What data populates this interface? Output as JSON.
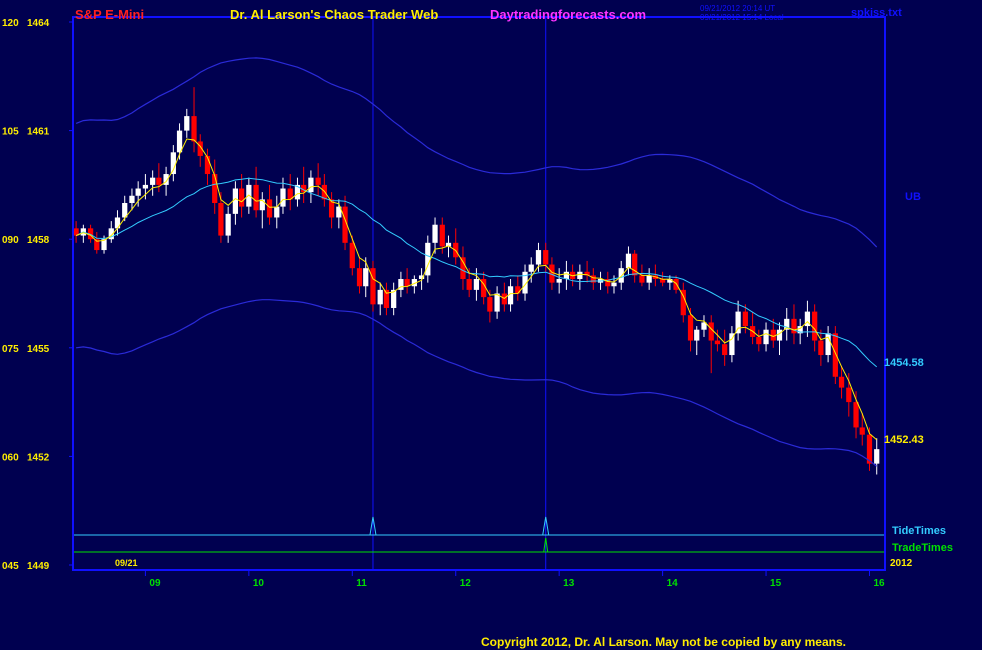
{
  "header": {
    "instrument": "S&P E-Mini",
    "title": "Dr. Al Larson's Chaos Trader Web",
    "site": "Daytradingforecasts.com",
    "time_utc": "09/21/2012 20:14 UT",
    "time_local": "09/21/2012 15:14 Local",
    "file": "spkiss.txt"
  },
  "footer": {
    "copyright": "Copyright 2012, Dr. Al Larson. May not be copied by any means."
  },
  "chart_data": {
    "type": "candlestick",
    "y_axis": {
      "ylim": [
        1449,
        1464
      ],
      "ticks": [
        {
          "code": "120",
          "price": "1464",
          "value": 1464
        },
        {
          "code": "105",
          "price": "1461",
          "value": 1461
        },
        {
          "code": "090",
          "price": "1458",
          "value": 1458
        },
        {
          "code": "075",
          "price": "1455",
          "value": 1455
        },
        {
          "code": "060",
          "price": "1452",
          "value": 1452
        },
        {
          "code": "045",
          "price": "1449",
          "value": 1449
        }
      ]
    },
    "x_axis": {
      "xlim": [
        8.3,
        16.15
      ],
      "ticks": [
        {
          "label": "09",
          "value": 9
        },
        {
          "label": "10",
          "value": 10
        },
        {
          "label": "11",
          "value": 11
        },
        {
          "label": "12",
          "value": 12
        },
        {
          "label": "13",
          "value": 13
        },
        {
          "label": "14",
          "value": 14
        },
        {
          "label": "15",
          "value": 15
        },
        {
          "label": "16",
          "value": 16
        }
      ],
      "date_label": "09/21",
      "year_label": "2012"
    },
    "colors": {
      "up": "#ffffff",
      "down": "#ff0000",
      "frame": "#1010ff",
      "bands": "#2a2ad8",
      "mid": "#33ccff",
      "fast": "#ffee00",
      "tide": "#33ccff",
      "trade": "#00e000"
    },
    "labels": {
      "upper_band": "UB",
      "mid_value": "1454.58",
      "fast_value": "1452.43",
      "tide": "TideTimes",
      "trade": "TradeTimes"
    },
    "markers": [
      11.2,
      12.87
    ],
    "candles": [
      [
        8.33,
        1458.3,
        1458.5,
        1457.9,
        1458.1
      ],
      [
        8.4,
        1458.1,
        1458.4,
        1457.9,
        1458.3
      ],
      [
        8.47,
        1458.3,
        1458.4,
        1457.9,
        1458.0
      ],
      [
        8.53,
        1458.0,
        1458.2,
        1457.6,
        1457.7
      ],
      [
        8.6,
        1457.7,
        1458.1,
        1457.6,
        1458.0
      ],
      [
        8.67,
        1458.0,
        1458.5,
        1457.9,
        1458.3
      ],
      [
        8.73,
        1458.3,
        1458.8,
        1458.1,
        1458.6
      ],
      [
        8.8,
        1458.6,
        1459.2,
        1458.5,
        1459.0
      ],
      [
        8.87,
        1459.0,
        1459.4,
        1458.8,
        1459.2
      ],
      [
        8.93,
        1459.2,
        1459.6,
        1458.9,
        1459.4
      ],
      [
        9.0,
        1459.4,
        1459.8,
        1459.1,
        1459.5
      ],
      [
        9.07,
        1459.5,
        1459.9,
        1459.2,
        1459.7
      ],
      [
        9.13,
        1459.7,
        1460.1,
        1459.3,
        1459.5
      ],
      [
        9.2,
        1459.5,
        1460.0,
        1459.2,
        1459.8
      ],
      [
        9.27,
        1459.8,
        1460.6,
        1459.6,
        1460.4
      ],
      [
        9.33,
        1460.4,
        1461.2,
        1460.2,
        1461.0
      ],
      [
        9.4,
        1461.0,
        1461.6,
        1460.8,
        1461.4
      ],
      [
        9.47,
        1461.4,
        1462.2,
        1460.4,
        1460.7
      ],
      [
        9.53,
        1460.7,
        1460.9,
        1460.0,
        1460.3
      ],
      [
        9.6,
        1460.3,
        1460.5,
        1459.5,
        1459.8
      ],
      [
        9.67,
        1459.8,
        1460.2,
        1458.7,
        1459.0
      ],
      [
        9.73,
        1459.0,
        1459.3,
        1457.9,
        1458.1
      ],
      [
        9.8,
        1458.1,
        1458.9,
        1457.9,
        1458.7
      ],
      [
        9.87,
        1458.7,
        1459.6,
        1458.4,
        1459.4
      ],
      [
        9.93,
        1459.4,
        1459.8,
        1458.6,
        1458.9
      ],
      [
        10.0,
        1458.9,
        1459.7,
        1458.7,
        1459.5
      ],
      [
        10.07,
        1459.5,
        1460.0,
        1458.6,
        1458.8
      ],
      [
        10.13,
        1458.8,
        1459.3,
        1458.3,
        1459.1
      ],
      [
        10.2,
        1459.1,
        1459.5,
        1458.4,
        1458.6
      ],
      [
        10.27,
        1458.6,
        1459.2,
        1458.3,
        1458.9
      ],
      [
        10.33,
        1458.9,
        1459.7,
        1458.7,
        1459.4
      ],
      [
        10.4,
        1459.4,
        1459.8,
        1458.8,
        1459.1
      ],
      [
        10.47,
        1459.1,
        1459.7,
        1458.9,
        1459.5
      ],
      [
        10.53,
        1459.5,
        1460.0,
        1459.0,
        1459.3
      ],
      [
        10.6,
        1459.3,
        1459.9,
        1459.0,
        1459.7
      ],
      [
        10.67,
        1459.7,
        1460.1,
        1459.2,
        1459.5
      ],
      [
        10.73,
        1459.5,
        1459.8,
        1458.9,
        1459.1
      ],
      [
        10.8,
        1459.1,
        1459.3,
        1458.3,
        1458.6
      ],
      [
        10.87,
        1458.6,
        1459.1,
        1458.3,
        1458.9
      ],
      [
        10.93,
        1458.9,
        1459.2,
        1457.7,
        1457.9
      ],
      [
        11.0,
        1457.9,
        1458.1,
        1457.0,
        1457.2
      ],
      [
        11.07,
        1457.2,
        1457.5,
        1456.5,
        1456.7
      ],
      [
        11.13,
        1456.7,
        1457.5,
        1456.4,
        1457.2
      ],
      [
        11.2,
        1457.2,
        1457.4,
        1456.0,
        1456.2
      ],
      [
        11.27,
        1456.2,
        1456.8,
        1455.9,
        1456.6
      ],
      [
        11.33,
        1456.6,
        1456.8,
        1455.9,
        1456.1
      ],
      [
        11.4,
        1456.1,
        1456.8,
        1455.9,
        1456.6
      ],
      [
        11.47,
        1456.6,
        1457.1,
        1456.4,
        1456.9
      ],
      [
        11.53,
        1456.9,
        1457.2,
        1456.5,
        1456.7
      ],
      [
        11.6,
        1456.7,
        1457.0,
        1456.5,
        1456.9
      ],
      [
        11.67,
        1456.9,
        1457.2,
        1456.6,
        1457.0
      ],
      [
        11.73,
        1457.0,
        1458.1,
        1456.8,
        1457.9
      ],
      [
        11.8,
        1457.9,
        1458.6,
        1457.6,
        1458.4
      ],
      [
        11.87,
        1458.4,
        1458.6,
        1457.6,
        1457.8
      ],
      [
        11.93,
        1457.8,
        1458.1,
        1457.5,
        1457.9
      ],
      [
        12.0,
        1457.9,
        1458.3,
        1457.3,
        1457.5
      ],
      [
        12.07,
        1457.5,
        1457.8,
        1456.6,
        1456.9
      ],
      [
        12.13,
        1456.9,
        1457.2,
        1456.4,
        1456.6
      ],
      [
        12.2,
        1456.6,
        1457.2,
        1456.3,
        1456.9
      ],
      [
        12.27,
        1456.9,
        1457.1,
        1456.2,
        1456.4
      ],
      [
        12.33,
        1456.4,
        1456.6,
        1455.7,
        1456.0
      ],
      [
        12.4,
        1456.0,
        1456.7,
        1455.8,
        1456.5
      ],
      [
        12.47,
        1456.5,
        1456.8,
        1456.0,
        1456.2
      ],
      [
        12.53,
        1456.2,
        1456.9,
        1456.0,
        1456.7
      ],
      [
        12.6,
        1456.7,
        1457.0,
        1456.3,
        1456.5
      ],
      [
        12.67,
        1456.5,
        1457.3,
        1456.3,
        1457.1
      ],
      [
        12.73,
        1457.1,
        1457.5,
        1456.8,
        1457.3
      ],
      [
        12.8,
        1457.3,
        1457.9,
        1457.1,
        1457.7
      ],
      [
        12.87,
        1457.7,
        1457.9,
        1457.1,
        1457.3
      ],
      [
        12.93,
        1457.3,
        1457.5,
        1456.6,
        1456.8
      ],
      [
        13.0,
        1456.8,
        1457.2,
        1456.5,
        1456.9
      ],
      [
        13.07,
        1456.9,
        1457.4,
        1456.6,
        1457.1
      ],
      [
        13.13,
        1457.1,
        1457.3,
        1456.7,
        1456.9
      ],
      [
        13.2,
        1456.9,
        1457.3,
        1456.6,
        1457.1
      ],
      [
        13.27,
        1457.1,
        1457.4,
        1456.8,
        1457.0
      ],
      [
        13.33,
        1457.0,
        1457.2,
        1456.6,
        1456.8
      ],
      [
        13.4,
        1456.8,
        1457.1,
        1456.6,
        1456.9
      ],
      [
        13.47,
        1456.9,
        1457.1,
        1456.5,
        1456.7
      ],
      [
        13.53,
        1456.7,
        1457.0,
        1456.5,
        1456.8
      ],
      [
        13.6,
        1456.8,
        1457.4,
        1456.6,
        1457.2
      ],
      [
        13.67,
        1457.2,
        1457.8,
        1457.0,
        1457.6
      ],
      [
        13.73,
        1457.6,
        1457.7,
        1456.8,
        1457.0
      ],
      [
        13.8,
        1457.0,
        1457.3,
        1456.7,
        1456.8
      ],
      [
        13.87,
        1456.8,
        1457.2,
        1456.6,
        1457.0
      ],
      [
        13.93,
        1457.0,
        1457.3,
        1456.7,
        1456.9
      ],
      [
        14.0,
        1456.9,
        1457.1,
        1456.7,
        1456.8
      ],
      [
        14.07,
        1456.8,
        1457.0,
        1456.6,
        1456.9
      ],
      [
        14.13,
        1456.9,
        1457.0,
        1456.5,
        1456.6
      ],
      [
        14.2,
        1456.6,
        1456.8,
        1455.7,
        1455.9
      ],
      [
        14.27,
        1455.9,
        1456.1,
        1454.9,
        1455.2
      ],
      [
        14.33,
        1455.2,
        1455.6,
        1454.8,
        1455.5
      ],
      [
        14.4,
        1455.5,
        1455.9,
        1455.3,
        1455.7
      ],
      [
        14.47,
        1455.7,
        1455.9,
        1454.3,
        1455.2
      ],
      [
        14.53,
        1455.2,
        1455.5,
        1454.9,
        1455.1
      ],
      [
        14.6,
        1455.1,
        1455.5,
        1454.5,
        1454.8
      ],
      [
        14.67,
        1454.8,
        1455.6,
        1454.6,
        1455.4
      ],
      [
        14.73,
        1455.4,
        1456.3,
        1455.2,
        1456.0
      ],
      [
        14.8,
        1456.0,
        1456.2,
        1455.4,
        1455.6
      ],
      [
        14.87,
        1455.6,
        1456.0,
        1455.1,
        1455.3
      ],
      [
        14.93,
        1455.3,
        1455.5,
        1454.9,
        1455.1
      ],
      [
        15.0,
        1455.1,
        1455.7,
        1454.9,
        1455.5
      ],
      [
        15.07,
        1455.5,
        1455.8,
        1455.0,
        1455.2
      ],
      [
        15.13,
        1455.2,
        1455.7,
        1454.8,
        1455.5
      ],
      [
        15.2,
        1455.5,
        1456.1,
        1455.2,
        1455.8
      ],
      [
        15.27,
        1455.8,
        1456.2,
        1455.1,
        1455.4
      ],
      [
        15.33,
        1455.4,
        1455.8,
        1455.1,
        1455.6
      ],
      [
        15.4,
        1455.6,
        1456.3,
        1455.3,
        1456.0
      ],
      [
        15.47,
        1456.0,
        1456.2,
        1454.9,
        1455.2
      ],
      [
        15.53,
        1455.2,
        1455.5,
        1454.5,
        1454.8
      ],
      [
        15.6,
        1454.8,
        1455.6,
        1454.6,
        1455.4
      ],
      [
        15.67,
        1455.4,
        1455.6,
        1454.0,
        1454.2
      ],
      [
        15.73,
        1454.2,
        1454.5,
        1453.6,
        1453.9
      ],
      [
        15.8,
        1453.9,
        1454.3,
        1453.1,
        1453.5
      ],
      [
        15.87,
        1453.5,
        1453.8,
        1452.5,
        1452.8
      ],
      [
        15.93,
        1452.8,
        1453.2,
        1452.3,
        1452.6
      ],
      [
        16.0,
        1452.6,
        1452.8,
        1451.6,
        1451.8
      ],
      [
        16.07,
        1451.8,
        1452.5,
        1451.5,
        1452.2
      ]
    ]
  }
}
